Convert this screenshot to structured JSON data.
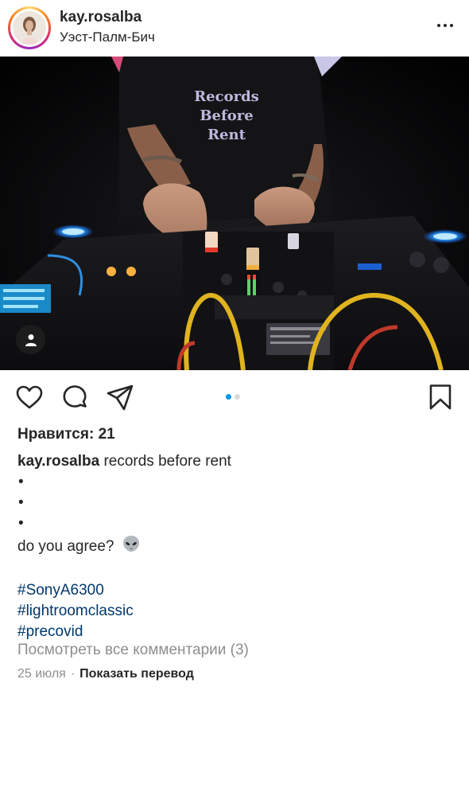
{
  "post": {
    "username": "kay.rosalba",
    "location": "Уэст-Палм-Бич",
    "photo_shirt_text": [
      "Records",
      "Before",
      "Rent"
    ],
    "carousel": {
      "count": 2,
      "active_index": 0
    },
    "likes": "Нравится: 21",
    "caption": {
      "username": "kay.rosalba",
      "text": "records before rent",
      "bullets": [
        "•",
        "•",
        "•"
      ],
      "question": "do you agree?",
      "emoji": "alien-emoji",
      "hashtags": [
        "#SonyA6300",
        "#lightroomclassic",
        "#precovid"
      ]
    },
    "view_comments": "Посмотреть все комментарии (3)",
    "date": "25 июля",
    "separator": "·",
    "translate": "Показать перевод"
  },
  "icons": {
    "more": "more-horizontal-icon",
    "tag": "user-tag-icon",
    "like": "heart-icon",
    "comment": "comment-icon",
    "share": "send-icon",
    "save": "bookmark-icon"
  },
  "colors": {
    "text": "#262626",
    "muted": "#8e8e8e",
    "hashtag": "#00376b",
    "carousel_active": "#0095f6",
    "carousel_inactive": "#dbdbdb"
  }
}
